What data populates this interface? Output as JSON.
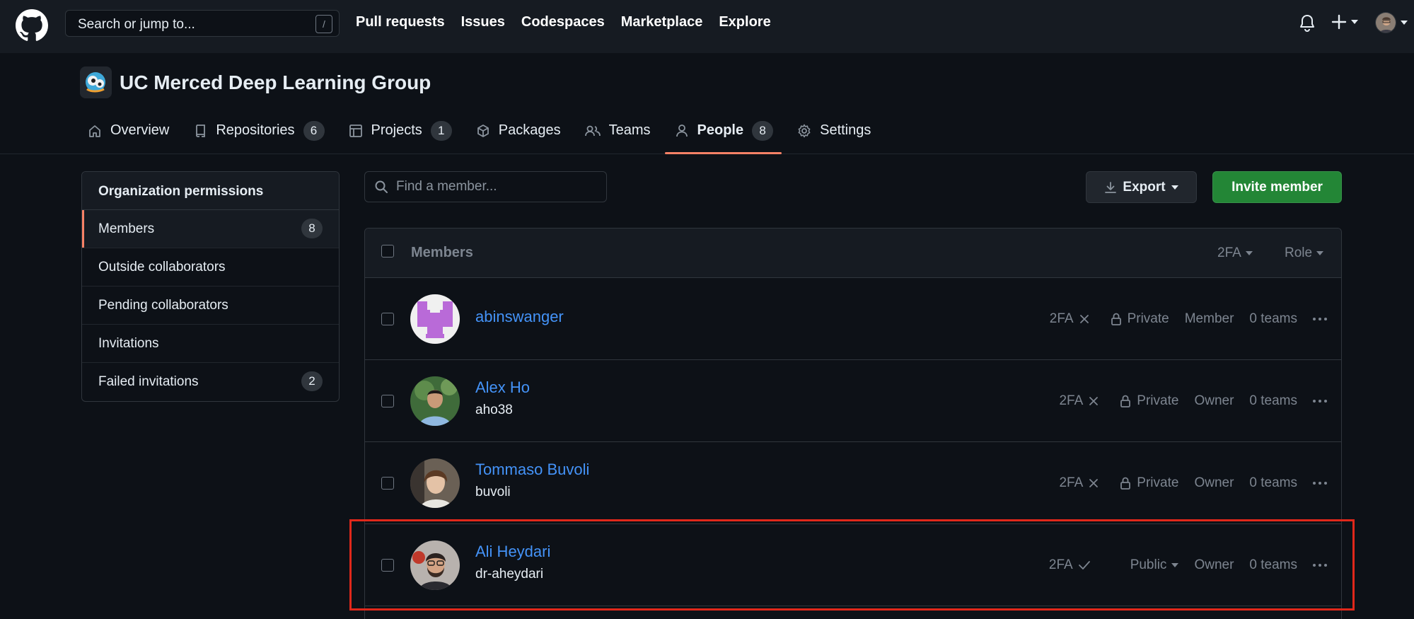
{
  "header": {
    "search_placeholder": "Search or jump to...",
    "search_shortcut": "/",
    "nav": [
      "Pull requests",
      "Issues",
      "Codespaces",
      "Marketplace",
      "Explore"
    ]
  },
  "org": {
    "name": "UC Merced Deep Learning Group",
    "tabs": [
      {
        "label": "Overview",
        "count": ""
      },
      {
        "label": "Repositories",
        "count": "6"
      },
      {
        "label": "Projects",
        "count": "1"
      },
      {
        "label": "Packages",
        "count": ""
      },
      {
        "label": "Teams",
        "count": ""
      },
      {
        "label": "People",
        "count": "8"
      },
      {
        "label": "Settings",
        "count": ""
      }
    ]
  },
  "sidebar": {
    "heading": "Organization permissions",
    "items": [
      {
        "label": "Members",
        "count": "8"
      },
      {
        "label": "Outside collaborators",
        "count": ""
      },
      {
        "label": "Pending collaborators",
        "count": ""
      },
      {
        "label": "Invitations",
        "count": ""
      },
      {
        "label": "Failed invitations",
        "count": "2"
      }
    ]
  },
  "toolbar": {
    "find_placeholder": "Find a member...",
    "export_label": "Export",
    "invite_label": "Invite member"
  },
  "members": {
    "header_title": "Members",
    "filter_2fa": "2FA",
    "filter_role": "Role",
    "rows": [
      {
        "name": "abinswanger",
        "login": "",
        "tfa": "2FA",
        "tfa_status": "disabled",
        "visibility": "Private",
        "role": "Member",
        "teams": "0 teams"
      },
      {
        "name": "Alex Ho",
        "login": "aho38",
        "tfa": "2FA",
        "tfa_status": "disabled",
        "visibility": "Private",
        "role": "Owner",
        "teams": "0 teams"
      },
      {
        "name": "Tommaso Buvoli",
        "login": "buvoli",
        "tfa": "2FA",
        "tfa_status": "disabled",
        "visibility": "Private",
        "role": "Owner",
        "teams": "0 teams"
      },
      {
        "name": "Ali Heydari",
        "login": "dr-aheydari",
        "tfa": "2FA",
        "tfa_status": "enabled",
        "visibility": "Public",
        "role": "Owner",
        "teams": "0 teams"
      }
    ]
  },
  "colors": {
    "accent_link": "#4493f8",
    "invite_green": "#238636",
    "selected_underline": "#f78166",
    "highlight_box": "#e0281b"
  }
}
